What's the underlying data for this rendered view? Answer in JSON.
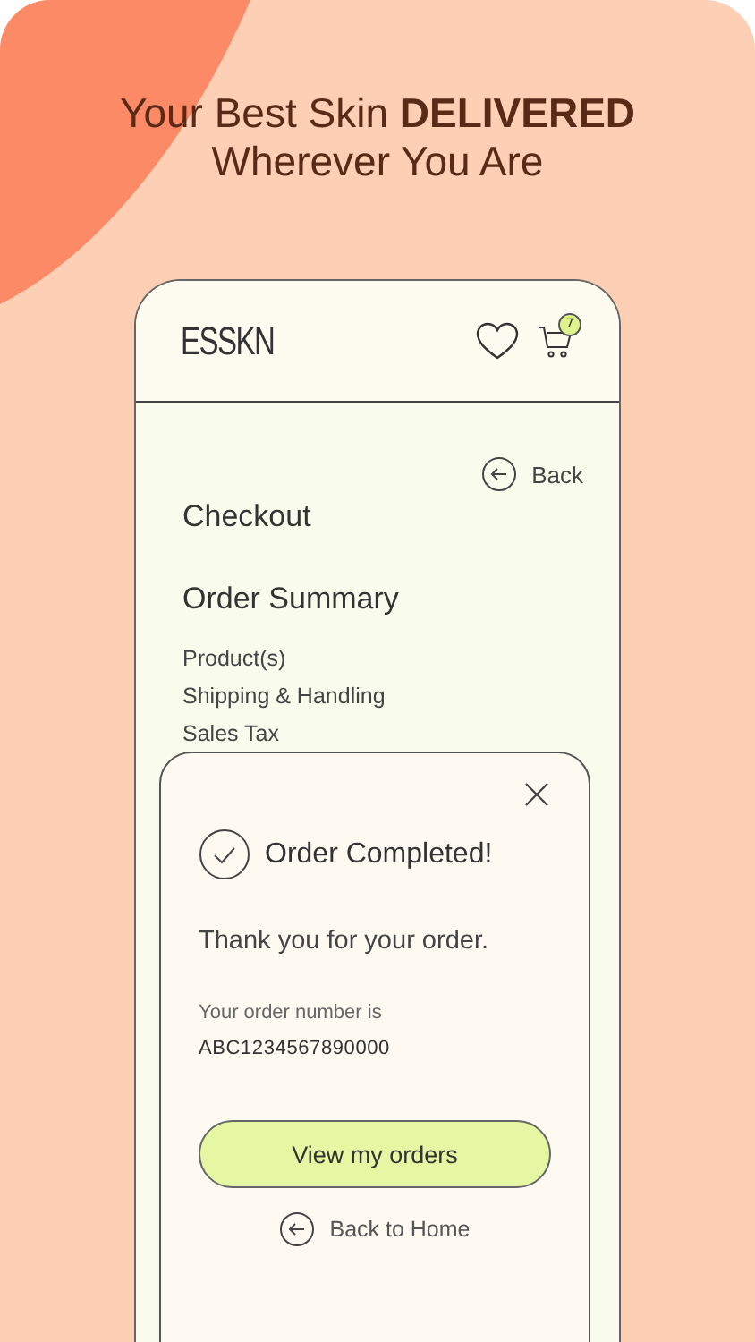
{
  "headline": [
    "Your Best Skin **DELIVERED**",
    "Wherever You Are"
  ],
  "header": {
    "logo": "ESSKN",
    "cart_count": "7"
  },
  "checkout": {
    "back": "Back",
    "title": "Checkout",
    "section": "Order Summary",
    "lines": [
      "Product(s)",
      "Shipping & Handling",
      "Sales Tax"
    ]
  },
  "modal": {
    "title": "Order Completed!",
    "message": "Thank you for your order.",
    "order_label": "Your order number is",
    "order_number": "ABC1234567890000",
    "primary_button": "View my orders",
    "secondary_link": "Back to Home"
  }
}
